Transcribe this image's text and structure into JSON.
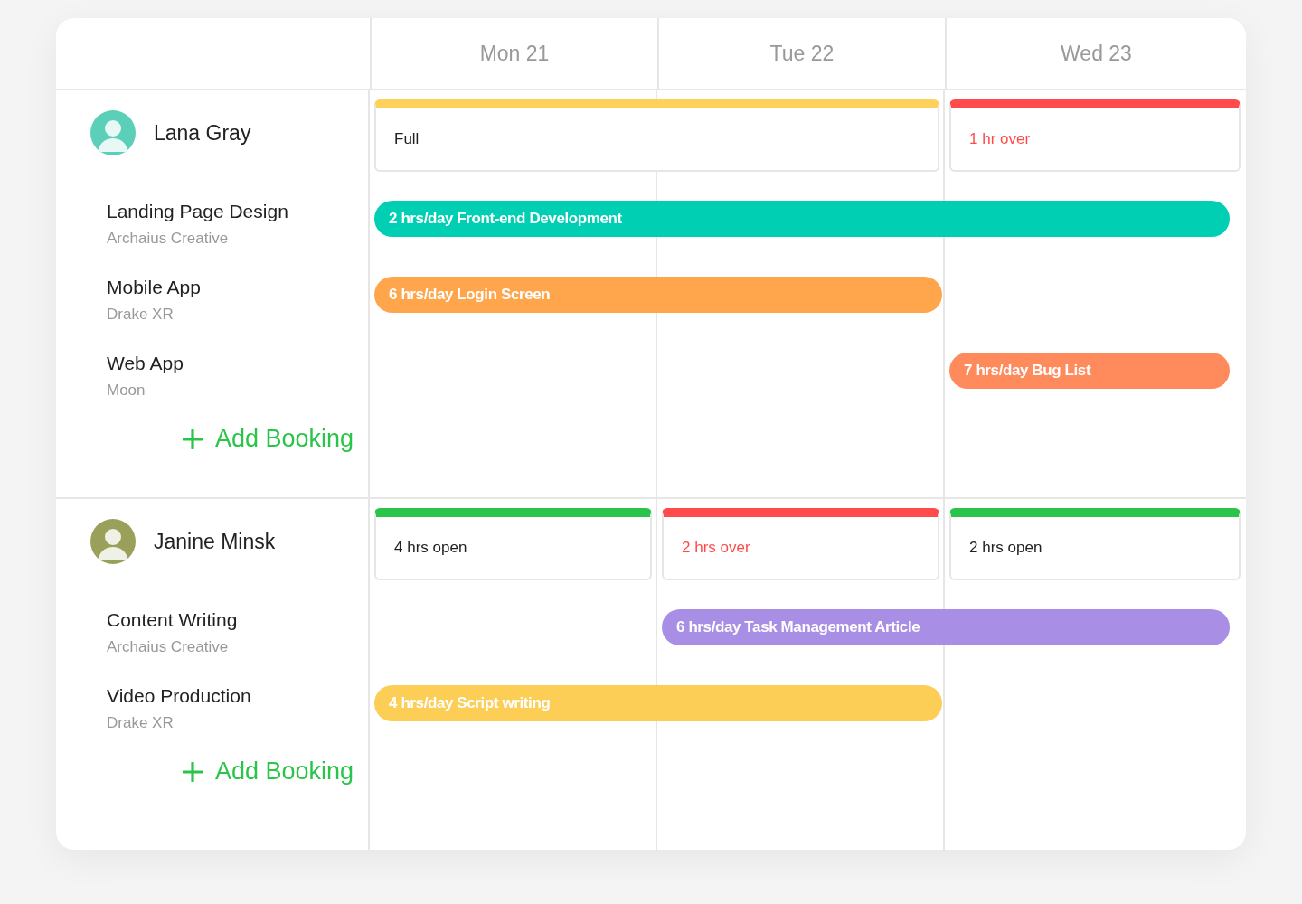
{
  "days": [
    {
      "label": "Mon 21"
    },
    {
      "label": "Tue 22"
    },
    {
      "label": "Wed 23"
    }
  ],
  "people": [
    {
      "name": "Lana Gray",
      "capacity": [
        {
          "label": "Full",
          "kind": "full",
          "merged_with_next": true
        },
        {
          "label": "1 hr over",
          "kind": "over",
          "merged_with_next": false
        }
      ],
      "projects": [
        {
          "title": "Landing Page Design",
          "client": "Archaius Creative",
          "booking": "2 hrs/day Front-end Development",
          "color": "#00cfb4",
          "booked": [
            true,
            true,
            true
          ]
        },
        {
          "title": "Mobile App",
          "client": "Drake XR",
          "booking": "6 hrs/day Login Screen",
          "color": "#ffa64d",
          "booked": [
            true,
            true,
            false
          ]
        },
        {
          "title": "Web App",
          "client": "Moon",
          "booking": "7 hrs/day Bug List",
          "color": "#ff8a5b",
          "booked": [
            false,
            false,
            true
          ]
        }
      ],
      "add_label": "Add Booking"
    },
    {
      "name": "Janine Minsk",
      "capacity": [
        {
          "label": "4 hrs open",
          "kind": "open",
          "merged_with_next": false
        },
        {
          "label": "2 hrs over",
          "kind": "over",
          "merged_with_next": false
        },
        {
          "label": "2 hrs open",
          "kind": "open",
          "merged_with_next": false
        }
      ],
      "projects": [
        {
          "title": "Content Writing",
          "client": "Archaius Creative",
          "booking": "6 hrs/day Task Management Article",
          "color": "#a98ee6",
          "booked": [
            false,
            true,
            true
          ]
        },
        {
          "title": "Video Production",
          "client": "Drake XR",
          "booking": "4 hrs/day Script writing",
          "color": "#fcce55",
          "booked": [
            true,
            true,
            false
          ]
        }
      ],
      "add_label": "Add Booking"
    }
  ]
}
